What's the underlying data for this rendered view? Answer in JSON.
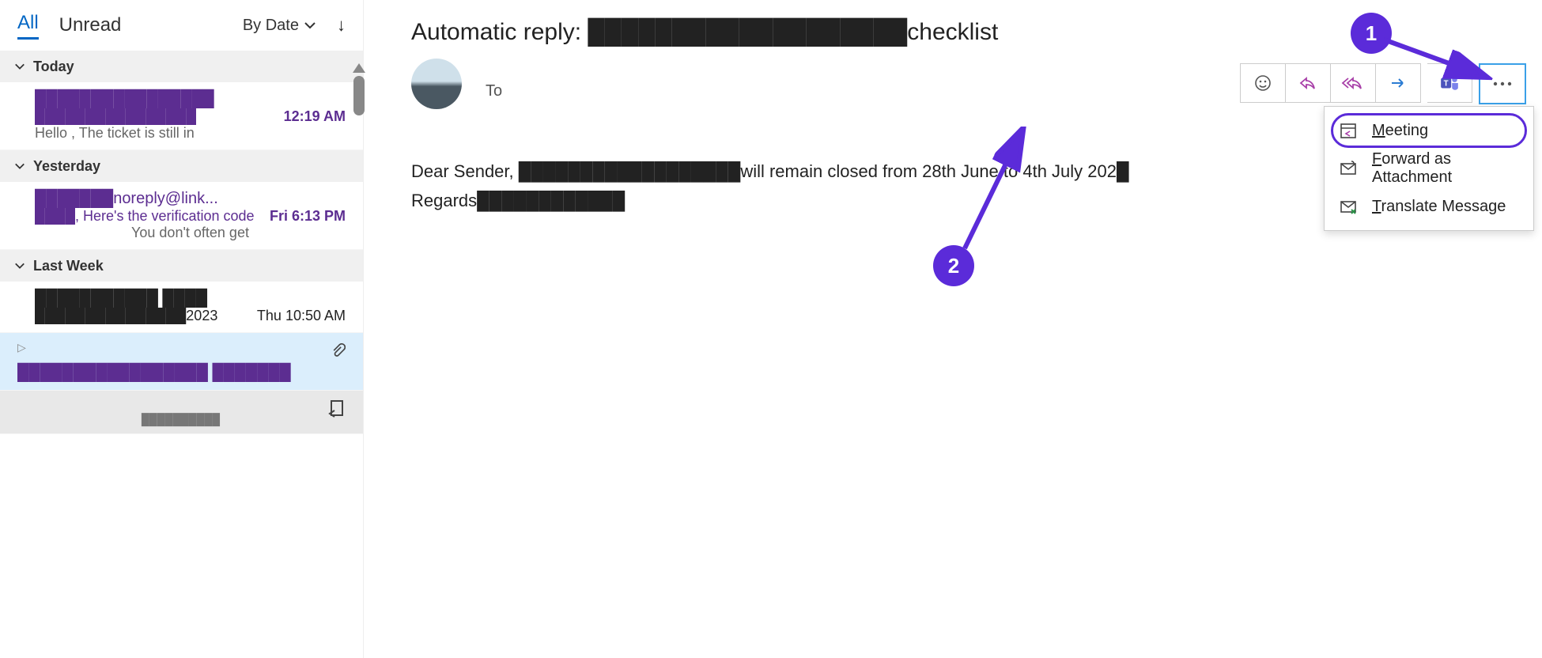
{
  "filter": {
    "all": "All",
    "unread": "Unread",
    "sort": "By Date"
  },
  "groups": {
    "today": "Today",
    "yesterday": "Yesterday",
    "lastweek": "Last Week"
  },
  "msgs": {
    "m1": {
      "from": "████████████████",
      "subj": "████████████████",
      "time": "12:19 AM",
      "prev": "Hello ,  The ticket is still in"
    },
    "m2": {
      "from": "███████noreply@link...",
      "subj": "████, Here's the verification code",
      "time": "Fri 6:13 PM",
      "prev": "You don't often get"
    },
    "m3": {
      "from": "███████████ ████",
      "subj": "███████████████2023",
      "time": "Thu 10:50 AM"
    },
    "m4": {
      "subj": "█████████████████ ███████"
    },
    "m5": {
      "subj": "██████████"
    }
  },
  "reading": {
    "subject": "Automatic reply: ███████████████████checklist",
    "to": "To",
    "body1": "Dear Sender,  ██████████████████will remain closed from 28th June to 4th July 202█",
    "body2": "Regards████████████"
  },
  "menu": {
    "meeting": "Meeting",
    "fwdatt": "Forward as Attachment",
    "translate": "Translate Message"
  },
  "callouts": {
    "c1": "1",
    "c2": "2"
  }
}
